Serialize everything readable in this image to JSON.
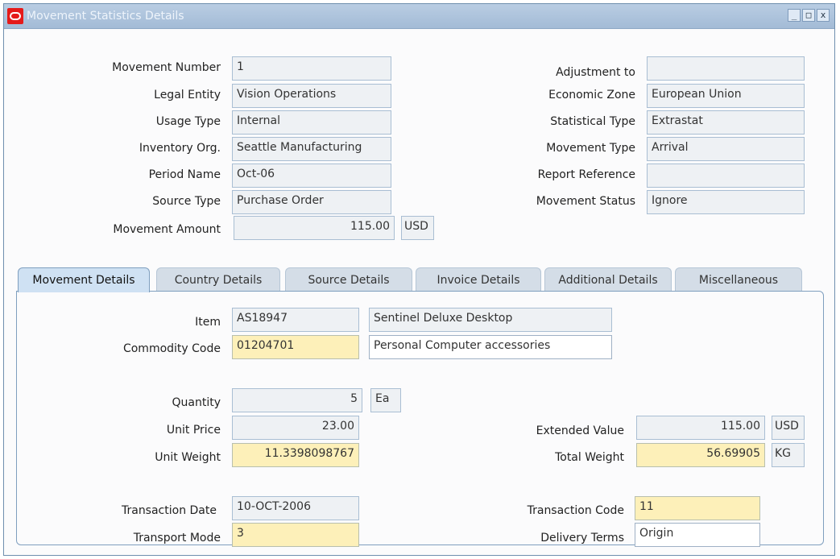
{
  "window": {
    "title": "Movement Statistics Details",
    "controls": [
      "_",
      "□",
      "x"
    ]
  },
  "header_left": [
    {
      "label": "Movement Number",
      "value": "1"
    },
    {
      "label": "Legal Entity",
      "value": "Vision Operations"
    },
    {
      "label": "Usage Type",
      "value": "Internal"
    },
    {
      "label": "Inventory Org.",
      "value": "Seattle Manufacturing"
    },
    {
      "label": "Period Name",
      "value": "Oct-06"
    },
    {
      "label": "Source Type",
      "value": "Purchase Order"
    },
    {
      "label": "Movement Amount",
      "value": "115.00",
      "currency": "USD"
    }
  ],
  "header_right": [
    {
      "label": "Adjustment to",
      "value": ""
    },
    {
      "label": "Economic Zone",
      "value": "European Union"
    },
    {
      "label": "Statistical Type",
      "value": "Extrastat"
    },
    {
      "label": "Movement Type",
      "value": "Arrival"
    },
    {
      "label": "Report Reference",
      "value": ""
    },
    {
      "label": "Movement Status",
      "value": "Ignore"
    }
  ],
  "tabs": [
    "Movement Details",
    "Country Details",
    "Source Details",
    "Invoice Details",
    "Additional Details",
    "Miscellaneous"
  ],
  "details": {
    "item_label": "Item",
    "item_value": "AS18947",
    "item_description": "Sentinel Deluxe Desktop",
    "commodity_label": "Commodity Code",
    "commodity_value": "01204701",
    "commodity_description": "Personal Computer accessories",
    "quantity_label": "Quantity",
    "quantity_value": "5",
    "quantity_uom": "Ea",
    "unit_price_label": "Unit Price",
    "unit_price_value": "23.00",
    "extended_value_label": "Extended Value",
    "extended_value_value": "115.00",
    "extended_value_currency": "USD",
    "unit_weight_label": "Unit Weight",
    "unit_weight_value": "11.3398098767",
    "total_weight_label": "Total Weight",
    "total_weight_value": "56.69905",
    "total_weight_uom": "KG",
    "transaction_date_label": "Transaction Date",
    "transaction_date_value": "10-OCT-2006",
    "transaction_code_label": "Transaction Code",
    "transaction_code_value": "11",
    "transport_mode_label": "Transport Mode",
    "transport_mode_value": "3",
    "delivery_terms_label": "Delivery Terms",
    "delivery_terms_value": "Origin"
  }
}
